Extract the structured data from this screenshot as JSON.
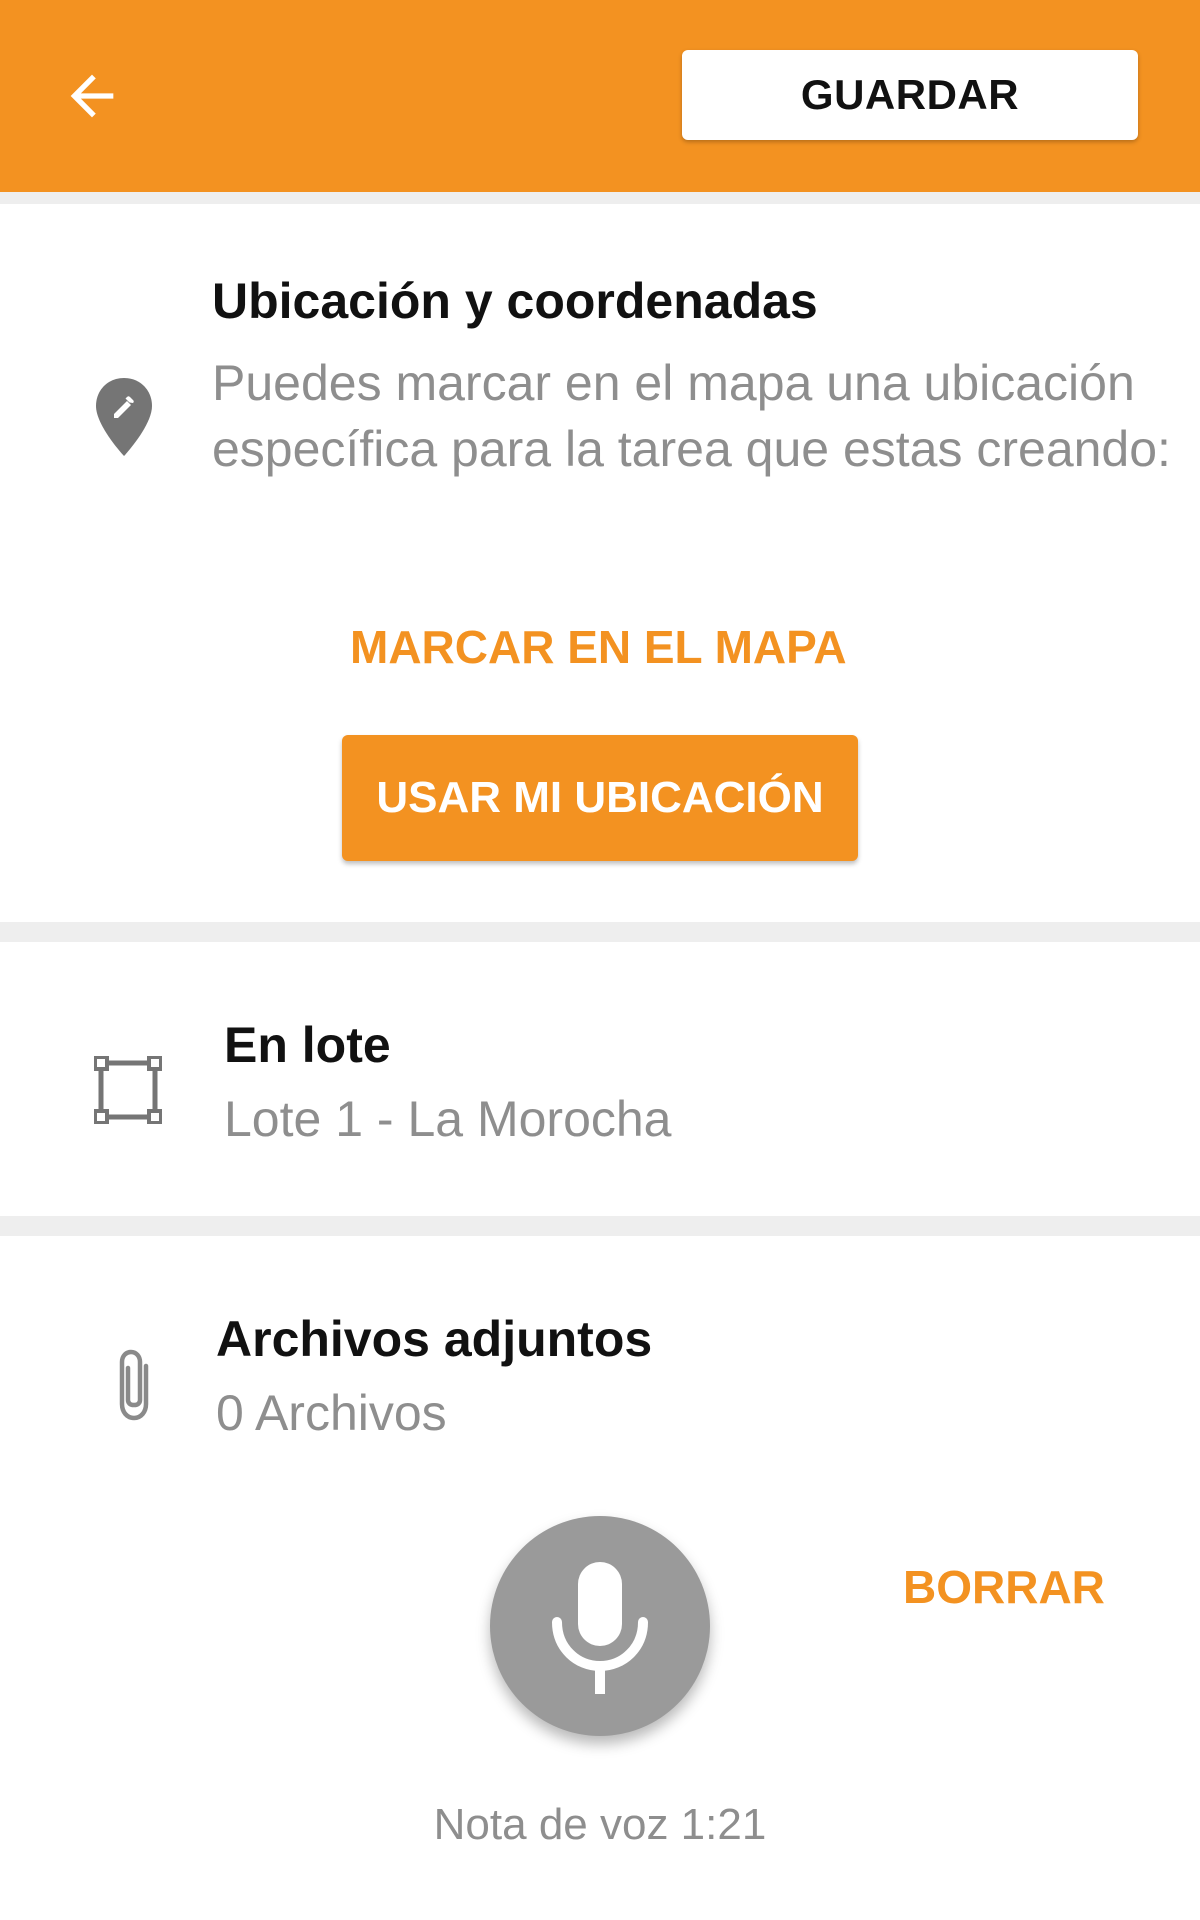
{
  "toolbar": {
    "back_icon": "arrow-back-icon",
    "save_label": "GUARDAR"
  },
  "location": {
    "icon": "map-pin-edit-icon",
    "title": "Ubicación y coordenadas",
    "description": "Puedes marcar en el mapa una ubicación específica para la tarea que estas creando:",
    "mark_on_map_label": "MARCAR EN EL MAPA",
    "use_my_location_label": "USAR MI UBICACIÓN"
  },
  "lot": {
    "icon": "polygon-select-icon",
    "title": "En lote",
    "value": "Lote 1 - La Morocha"
  },
  "attachments": {
    "icon": "paperclip-icon",
    "title": "Archivos adjuntos",
    "count_text": "0 Archivos"
  },
  "voice": {
    "icon": "microphone-icon",
    "delete_label": "BORRAR",
    "note_label": "Nota de voz 1:21"
  },
  "colors": {
    "accent": "#F39221",
    "text_primary": "#111111",
    "text_secondary": "#8E8E8E",
    "divider": "#EEEEEE",
    "mic_background": "#9A9A9A"
  }
}
